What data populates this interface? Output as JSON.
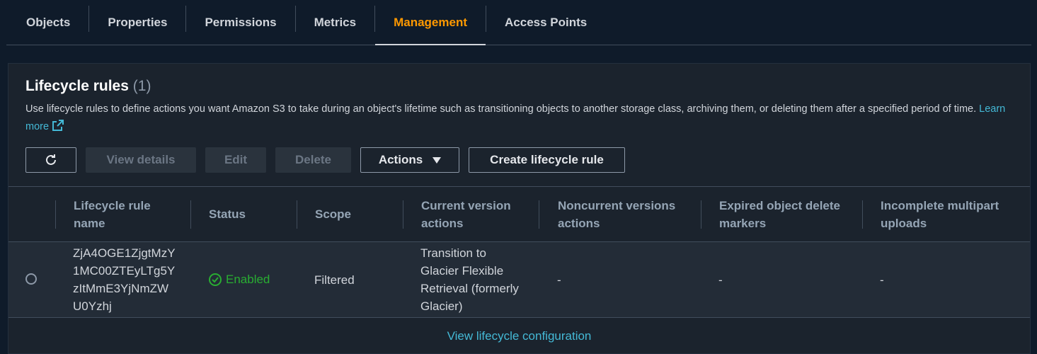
{
  "tabs": [
    {
      "label": "Objects",
      "active": false
    },
    {
      "label": "Properties",
      "active": false
    },
    {
      "label": "Permissions",
      "active": false
    },
    {
      "label": "Metrics",
      "active": false
    },
    {
      "label": "Management",
      "active": true
    },
    {
      "label": "Access Points",
      "active": false
    }
  ],
  "section": {
    "title": "Lifecycle rules",
    "count": "(1)",
    "description": "Use lifecycle rules to define actions you want Amazon S3 to take during an object's lifetime such as transitioning objects to another storage class, archiving them, or deleting them after a specified period of time.",
    "learn_more": "Learn more"
  },
  "toolbar": {
    "view_details": "View details",
    "edit": "Edit",
    "delete": "Delete",
    "actions": "Actions",
    "create": "Create lifecycle rule"
  },
  "table": {
    "columns": [
      "Lifecycle rule name",
      "Status",
      "Scope",
      "Current version actions",
      "Noncurrent versions actions",
      "Expired object delete markers",
      "Incomplete multipart uploads"
    ],
    "rows": [
      {
        "name": "ZjA4OGE1ZjgtMzY1MC00ZTEyLTg5YzItMmE3YjNmZWU0Yzhj",
        "status": "Enabled",
        "scope": "Filtered",
        "current_actions": "Transition to Glacier Flexible Retrieval (formerly Glacier)",
        "noncurrent_actions": "-",
        "expired_markers": "-",
        "multipart": "-"
      }
    ]
  },
  "footer": {
    "link": "View lifecycle configuration"
  },
  "colors": {
    "accent": "#ff9900",
    "link": "#44b9d6",
    "success": "#29ad32"
  },
  "icons": {
    "refresh": "refresh-icon",
    "external": "external-link-icon",
    "status": "check-circle-icon",
    "dropdown": "caret-down-icon"
  }
}
